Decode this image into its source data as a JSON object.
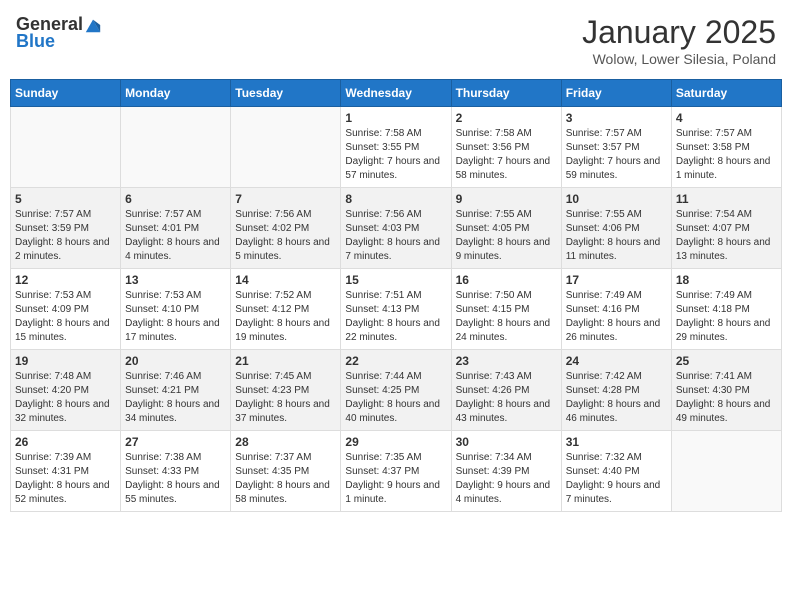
{
  "header": {
    "logo_general": "General",
    "logo_blue": "Blue",
    "month_title": "January 2025",
    "subtitle": "Wolow, Lower Silesia, Poland"
  },
  "weekdays": [
    "Sunday",
    "Monday",
    "Tuesday",
    "Wednesday",
    "Thursday",
    "Friday",
    "Saturday"
  ],
  "weeks": [
    [
      {
        "day": "",
        "sunrise": "",
        "sunset": "",
        "daylight": ""
      },
      {
        "day": "",
        "sunrise": "",
        "sunset": "",
        "daylight": ""
      },
      {
        "day": "",
        "sunrise": "",
        "sunset": "",
        "daylight": ""
      },
      {
        "day": "1",
        "sunrise": "Sunrise: 7:58 AM",
        "sunset": "Sunset: 3:55 PM",
        "daylight": "Daylight: 7 hours and 57 minutes."
      },
      {
        "day": "2",
        "sunrise": "Sunrise: 7:58 AM",
        "sunset": "Sunset: 3:56 PM",
        "daylight": "Daylight: 7 hours and 58 minutes."
      },
      {
        "day": "3",
        "sunrise": "Sunrise: 7:57 AM",
        "sunset": "Sunset: 3:57 PM",
        "daylight": "Daylight: 7 hours and 59 minutes."
      },
      {
        "day": "4",
        "sunrise": "Sunrise: 7:57 AM",
        "sunset": "Sunset: 3:58 PM",
        "daylight": "Daylight: 8 hours and 1 minute."
      }
    ],
    [
      {
        "day": "5",
        "sunrise": "Sunrise: 7:57 AM",
        "sunset": "Sunset: 3:59 PM",
        "daylight": "Daylight: 8 hours and 2 minutes."
      },
      {
        "day": "6",
        "sunrise": "Sunrise: 7:57 AM",
        "sunset": "Sunset: 4:01 PM",
        "daylight": "Daylight: 8 hours and 4 minutes."
      },
      {
        "day": "7",
        "sunrise": "Sunrise: 7:56 AM",
        "sunset": "Sunset: 4:02 PM",
        "daylight": "Daylight: 8 hours and 5 minutes."
      },
      {
        "day": "8",
        "sunrise": "Sunrise: 7:56 AM",
        "sunset": "Sunset: 4:03 PM",
        "daylight": "Daylight: 8 hours and 7 minutes."
      },
      {
        "day": "9",
        "sunrise": "Sunrise: 7:55 AM",
        "sunset": "Sunset: 4:05 PM",
        "daylight": "Daylight: 8 hours and 9 minutes."
      },
      {
        "day": "10",
        "sunrise": "Sunrise: 7:55 AM",
        "sunset": "Sunset: 4:06 PM",
        "daylight": "Daylight: 8 hours and 11 minutes."
      },
      {
        "day": "11",
        "sunrise": "Sunrise: 7:54 AM",
        "sunset": "Sunset: 4:07 PM",
        "daylight": "Daylight: 8 hours and 13 minutes."
      }
    ],
    [
      {
        "day": "12",
        "sunrise": "Sunrise: 7:53 AM",
        "sunset": "Sunset: 4:09 PM",
        "daylight": "Daylight: 8 hours and 15 minutes."
      },
      {
        "day": "13",
        "sunrise": "Sunrise: 7:53 AM",
        "sunset": "Sunset: 4:10 PM",
        "daylight": "Daylight: 8 hours and 17 minutes."
      },
      {
        "day": "14",
        "sunrise": "Sunrise: 7:52 AM",
        "sunset": "Sunset: 4:12 PM",
        "daylight": "Daylight: 8 hours and 19 minutes."
      },
      {
        "day": "15",
        "sunrise": "Sunrise: 7:51 AM",
        "sunset": "Sunset: 4:13 PM",
        "daylight": "Daylight: 8 hours and 22 minutes."
      },
      {
        "day": "16",
        "sunrise": "Sunrise: 7:50 AM",
        "sunset": "Sunset: 4:15 PM",
        "daylight": "Daylight: 8 hours and 24 minutes."
      },
      {
        "day": "17",
        "sunrise": "Sunrise: 7:49 AM",
        "sunset": "Sunset: 4:16 PM",
        "daylight": "Daylight: 8 hours and 26 minutes."
      },
      {
        "day": "18",
        "sunrise": "Sunrise: 7:49 AM",
        "sunset": "Sunset: 4:18 PM",
        "daylight": "Daylight: 8 hours and 29 minutes."
      }
    ],
    [
      {
        "day": "19",
        "sunrise": "Sunrise: 7:48 AM",
        "sunset": "Sunset: 4:20 PM",
        "daylight": "Daylight: 8 hours and 32 minutes."
      },
      {
        "day": "20",
        "sunrise": "Sunrise: 7:46 AM",
        "sunset": "Sunset: 4:21 PM",
        "daylight": "Daylight: 8 hours and 34 minutes."
      },
      {
        "day": "21",
        "sunrise": "Sunrise: 7:45 AM",
        "sunset": "Sunset: 4:23 PM",
        "daylight": "Daylight: 8 hours and 37 minutes."
      },
      {
        "day": "22",
        "sunrise": "Sunrise: 7:44 AM",
        "sunset": "Sunset: 4:25 PM",
        "daylight": "Daylight: 8 hours and 40 minutes."
      },
      {
        "day": "23",
        "sunrise": "Sunrise: 7:43 AM",
        "sunset": "Sunset: 4:26 PM",
        "daylight": "Daylight: 8 hours and 43 minutes."
      },
      {
        "day": "24",
        "sunrise": "Sunrise: 7:42 AM",
        "sunset": "Sunset: 4:28 PM",
        "daylight": "Daylight: 8 hours and 46 minutes."
      },
      {
        "day": "25",
        "sunrise": "Sunrise: 7:41 AM",
        "sunset": "Sunset: 4:30 PM",
        "daylight": "Daylight: 8 hours and 49 minutes."
      }
    ],
    [
      {
        "day": "26",
        "sunrise": "Sunrise: 7:39 AM",
        "sunset": "Sunset: 4:31 PM",
        "daylight": "Daylight: 8 hours and 52 minutes."
      },
      {
        "day": "27",
        "sunrise": "Sunrise: 7:38 AM",
        "sunset": "Sunset: 4:33 PM",
        "daylight": "Daylight: 8 hours and 55 minutes."
      },
      {
        "day": "28",
        "sunrise": "Sunrise: 7:37 AM",
        "sunset": "Sunset: 4:35 PM",
        "daylight": "Daylight: 8 hours and 58 minutes."
      },
      {
        "day": "29",
        "sunrise": "Sunrise: 7:35 AM",
        "sunset": "Sunset: 4:37 PM",
        "daylight": "Daylight: 9 hours and 1 minute."
      },
      {
        "day": "30",
        "sunrise": "Sunrise: 7:34 AM",
        "sunset": "Sunset: 4:39 PM",
        "daylight": "Daylight: 9 hours and 4 minutes."
      },
      {
        "day": "31",
        "sunrise": "Sunrise: 7:32 AM",
        "sunset": "Sunset: 4:40 PM",
        "daylight": "Daylight: 9 hours and 7 minutes."
      },
      {
        "day": "",
        "sunrise": "",
        "sunset": "",
        "daylight": ""
      }
    ]
  ]
}
